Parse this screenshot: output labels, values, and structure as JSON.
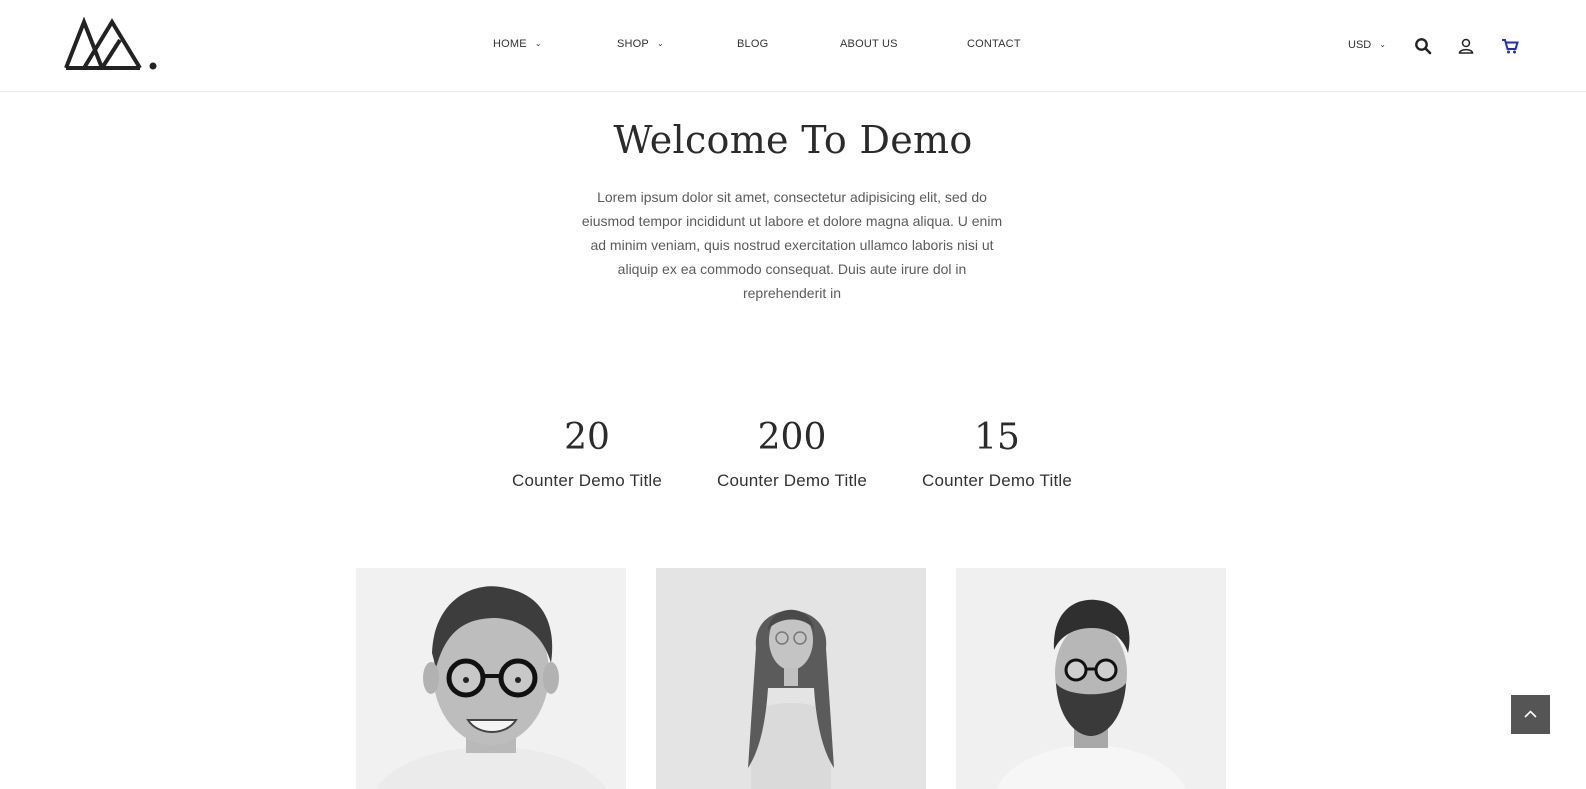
{
  "nav": {
    "items": [
      {
        "label": "HOME",
        "has_dropdown": true
      },
      {
        "label": "SHOP",
        "has_dropdown": true
      },
      {
        "label": "BLOG",
        "has_dropdown": false
      },
      {
        "label": "ABOUT US",
        "has_dropdown": false
      },
      {
        "label": "CONTACT",
        "has_dropdown": false
      }
    ]
  },
  "header": {
    "currency": "USD",
    "icons": [
      "search-icon",
      "user-icon",
      "cart-icon"
    ],
    "cart_color": "#1a2bd8"
  },
  "welcome": {
    "title": "Welcome To Demo",
    "text": "Lorem ipsum dolor sit amet, consectetur adipisicing elit, sed do eiusmod tempor incididunt ut labore et dolore magna aliqua. U enim ad minim veniam, quis nostrud exercitation ullamco laboris nisi ut aliquip ex ea commodo consequat. Duis aute irure dol in reprehenderit in"
  },
  "counters": [
    {
      "value": "20",
      "title": "Counter Demo Title"
    },
    {
      "value": "200",
      "title": "Counter Demo Title"
    },
    {
      "value": "15",
      "title": "Counter Demo Title"
    }
  ],
  "team": [
    {
      "photo": "man-with-glasses-smiling"
    },
    {
      "photo": "woman-with-glasses"
    },
    {
      "photo": "bearded-man-with-glasses"
    }
  ],
  "colors": {
    "text": "#2b2b2b",
    "border": "#e8e8e8",
    "back_to_top_bg": "#555555"
  }
}
